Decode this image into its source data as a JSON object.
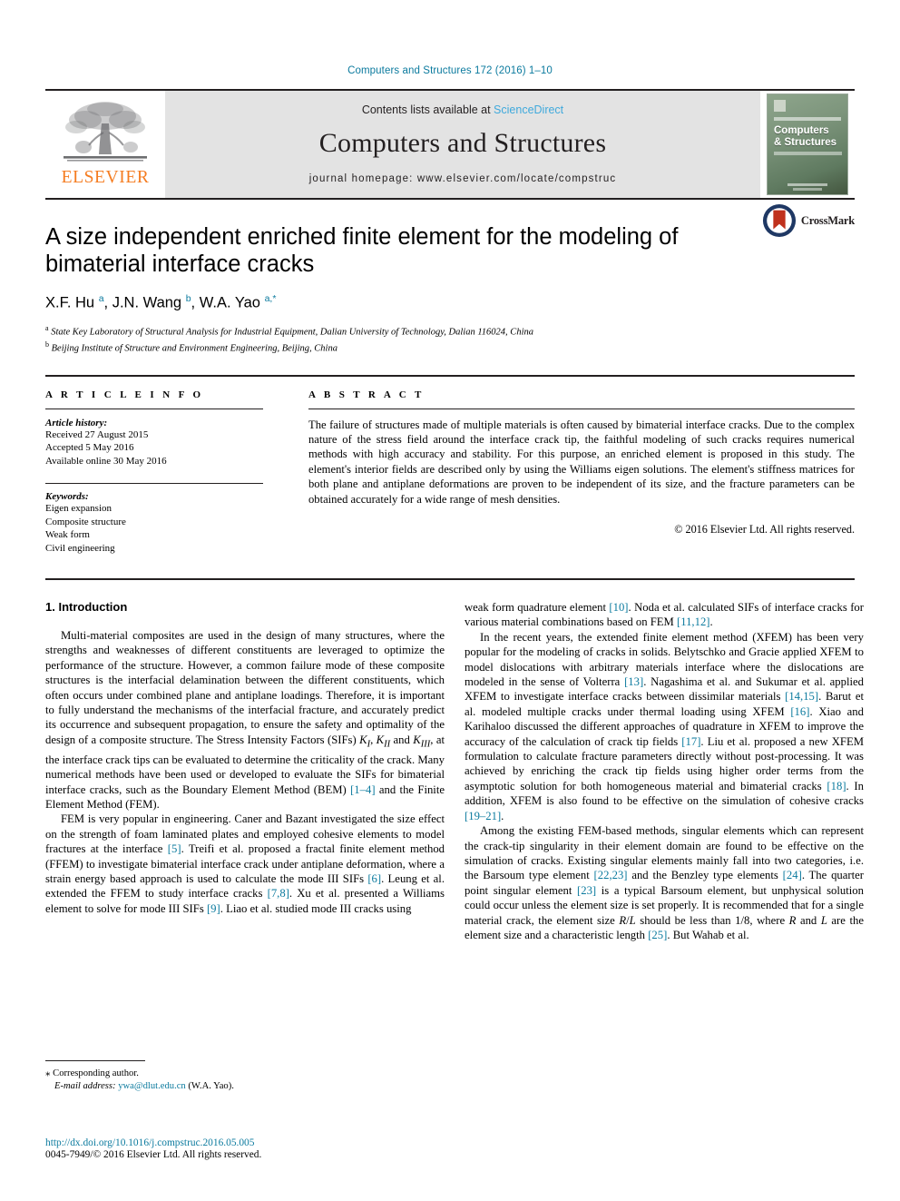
{
  "running_head": "Computers and Structures 172 (2016) 1–10",
  "masthead": {
    "contents_prefix": "Contents lists available at ",
    "sciencedirect": "ScienceDirect",
    "journal_title": "Computers and Structures",
    "homepage": "journal homepage: www.elsevier.com/locate/compstruc",
    "publisher_name": "ELSEVIER",
    "publisher_logo_icon": "elsevier-tree-icon",
    "cover": {
      "line1": "Computers",
      "line2": "& Structures"
    }
  },
  "colors": {
    "link": "#0b7a9e",
    "sciencedirect": "#3fa9dc",
    "elsevier_orange": "#f57c20",
    "masthead_bg": "#e3e3e3",
    "crossmark_circle": "#1f3864",
    "crossmark_flag": "#c0311d"
  },
  "article": {
    "title": "A size independent enriched finite element for the modeling of bimaterial interface cracks",
    "authors_html": "X.F. Hu <sup>a</sup>, J.N. Wang <sup>b</sup>, W.A. Yao <sup>a,</sup><sup>*</sup>",
    "affiliation_a": "State Key Laboratory of Structural Analysis for Industrial Equipment, Dalian University of Technology, Dalian 116024, China",
    "affiliation_b": "Beijing Institute of Structure and Environment Engineering, Beijing, China",
    "crossmark_label": "CrossMark"
  },
  "article_info": {
    "heading": "A R T I C L E  I N F O",
    "history_label": "Article history:",
    "history": [
      "Received 27 August 2015",
      "Accepted 5 May 2016",
      "Available online 30 May 2016"
    ],
    "keywords_label": "Keywords:",
    "keywords": [
      "Eigen expansion",
      "Composite structure",
      "Weak form",
      "Civil engineering"
    ]
  },
  "abstract": {
    "heading": "A B S T R A C T",
    "text": "The failure of structures made of multiple materials is often caused by bimaterial interface cracks. Due to the complex nature of the stress field around the interface crack tip, the faithful modeling of such cracks requires numerical methods with high accuracy and stability. For this purpose, an enriched element is proposed in this study. The element's interior fields are described only by using the Williams eigen solutions. The element's stiffness matrices for both plane and antiplane deformations are proven to be independent of its size, and the fracture parameters can be obtained accurately for a wide range of mesh densities.",
    "copyright": "© 2016 Elsevier Ltd. All rights reserved."
  },
  "body": {
    "section_heading": "1. Introduction",
    "left_paragraphs": [
      {
        "id": "p1",
        "html": "Multi-material composites are used in the design of many structures, where the strengths and weaknesses of different constituents are leveraged to optimize the performance of the structure. However, a common failure mode of these composite structures is the interfacial delamination between the different constituents, which often occurs under combined plane and antiplane loadings. Therefore, it is important to fully understand the mechanisms of the interfacial fracture, and accurately predict its occurrence and subsequent propagation, to ensure the safety and optimality of the design of a composite structure. The Stress Intensity Factors (SIFs) <span class=\"it\">K<sub>I</sub></span>, <span class=\"it\">K<sub>II</sub></span> and <span class=\"it\">K<sub>III</sub></span>, at the interface crack tips can be evaluated to determine the criticality of the crack. Many numerical methods have been used or developed to evaluate the SIFs for bimaterial interface cracks, such as the Boundary Element Method (BEM) <span class=\"lnk\">[1–4]</span> and the Finite Element Method (FEM)."
      },
      {
        "id": "p2",
        "html": "FEM is very popular in engineering. Caner and Bazant investigated the size effect on the strength of foam laminated plates and employed cohesive elements to model fractures at the interface <span class=\"lnk\">[5]</span>. Treifi et al. proposed a fractal finite element method (FFEM) to investigate bimaterial interface crack under antiplane deformation, where a strain energy based approach is used to calculate the mode III SIFs <span class=\"lnk\">[6]</span>. Leung et al. extended the FFEM to study interface cracks <span class=\"lnk\">[7,8]</span>. Xu et al. presented a Williams element to solve for mode III SIFs <span class=\"lnk\">[9]</span>. Liao et al. studied mode III cracks using"
      }
    ],
    "right_paragraphs": [
      {
        "id": "p3",
        "html": "weak form quadrature element <span class=\"lnk\">[10]</span>. Noda et al. calculated SIFs of interface cracks for various material combinations based on FEM <span class=\"lnk\">[11,12]</span>."
      },
      {
        "id": "p4",
        "html": "In the recent years, the extended finite element method (XFEM) has been very popular for the modeling of cracks in solids. Belytschko and Gracie applied XFEM to model dislocations with arbitrary materials interface where the dislocations are modeled in the sense of Volterra <span class=\"lnk\">[13]</span>. Nagashima et al. and Sukumar et al. applied XFEM to investigate interface cracks between dissimilar materials <span class=\"lnk\">[14,15]</span>. Barut et al. modeled multiple cracks under thermal loading using XFEM <span class=\"lnk\">[16]</span>. Xiao and Karihaloo discussed the different approaches of quadrature in XFEM to improve the accuracy of the calculation of crack tip fields <span class=\"lnk\">[17]</span>. Liu et al. proposed a new XFEM formulation to calculate fracture parameters directly without post-processing. It was achieved by enriching the crack tip fields using higher order terms from the asymptotic solution for both homogeneous material and bimaterial cracks <span class=\"lnk\">[18]</span>. In addition, XFEM is also found to be effective on the simulation of cohesive cracks <span class=\"lnk\">[19–21]</span>."
      },
      {
        "id": "p5",
        "html": "Among the existing FEM-based methods, singular elements which can represent the crack-tip singularity in their element domain are found to be effective on the simulation of cracks. Existing singular elements mainly fall into two categories, i.e. the Barsoum type element <span class=\"lnk\">[22,23]</span> and the Benzley type elements <span class=\"lnk\">[24]</span>. The quarter point singular element <span class=\"lnk\">[23]</span> is a typical Barsoum element, but unphysical solution could occur unless the element size is set properly. It is recommended that for a single material crack, the element size <span class=\"it\">R</span>/<span class=\"it\">L</span> should be less than 1/8, where <span class=\"it\">R</span> and <span class=\"it\">L</span> are the element size and a characteristic length <span class=\"lnk\">[25]</span>. But Wahab et al."
      }
    ]
  },
  "footnote": {
    "corresponding_marker": "⁎",
    "corresponding_text": "Corresponding author.",
    "email_label": "E-mail address:",
    "email": "ywa@dlut.edu.cn",
    "email_owner": "(W.A. Yao)."
  },
  "footer": {
    "doi": "http://dx.doi.org/10.1016/j.compstruc.2016.05.005",
    "issn_line": "0045-7949/© 2016 Elsevier Ltd. All rights reserved."
  }
}
